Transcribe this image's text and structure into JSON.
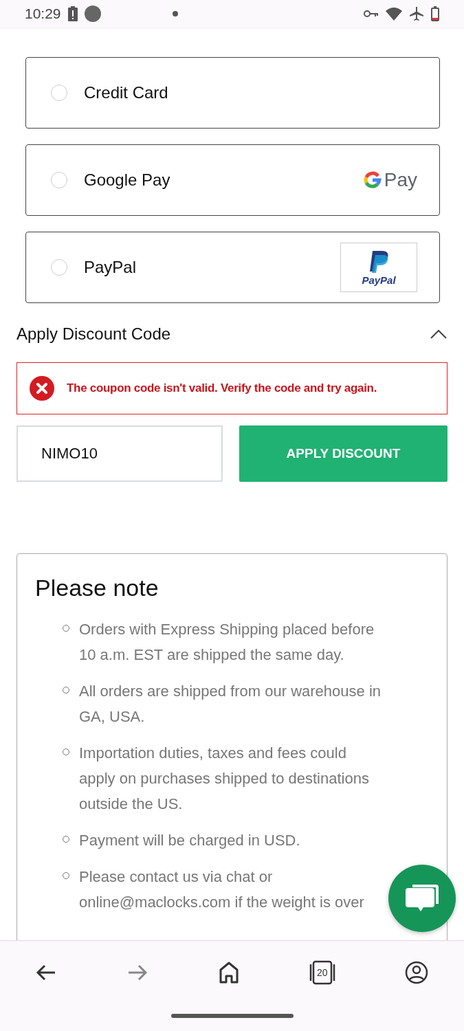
{
  "status_bar": {
    "time": "10:29"
  },
  "payment_options": [
    {
      "label": "Credit Card",
      "selected": false,
      "kind": "plain"
    },
    {
      "label": "Google Pay",
      "selected": false,
      "kind": "gpay",
      "logo_text": "Pay"
    },
    {
      "label": "PayPal",
      "selected": false,
      "kind": "paypal",
      "logo_text": "PayPal"
    }
  ],
  "discount": {
    "title": "Apply Discount Code",
    "expanded": true,
    "error": "The coupon code isn't valid. Verify the code and try again.",
    "value": "NIMO10",
    "button": "APPLY DISCOUNT"
  },
  "note": {
    "title": "Please note",
    "items": [
      "Orders with Express Shipping placed before 10 a.m. EST are shipped the same day.",
      "All orders are shipped from our warehouse in GA, USA.",
      "Importation duties, taxes and fees could apply on purchases shipped to destinations outside the US.",
      "Payment will be charged in USD.",
      "Please contact us via chat or online@maclocks.com if the weight is over"
    ]
  },
  "bottom_nav": {
    "tab_count": "20"
  }
}
